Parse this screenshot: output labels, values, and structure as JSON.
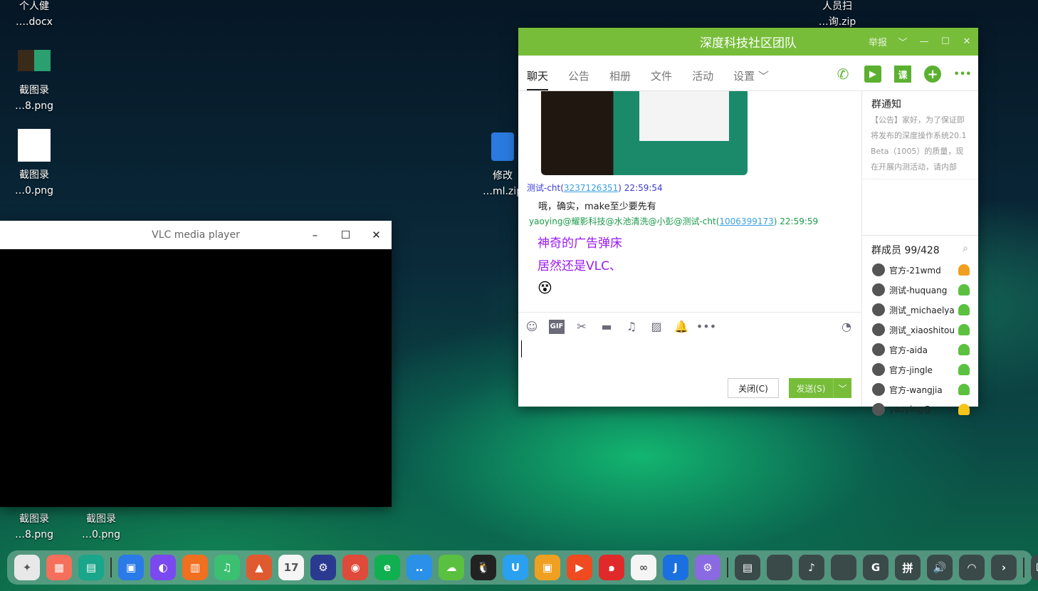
{
  "desktop": {
    "icons": [
      {
        "line1": "个人健",
        "line2": "….docx"
      },
      {
        "line1": "截图录",
        "line2": "…8.png"
      },
      {
        "line1": "截图录",
        "line2": "…0.png"
      },
      {
        "line1": "修改",
        "line2": "…ml.zip"
      },
      {
        "line1": "人员扫",
        "line2": "…询.zip"
      },
      {
        "line1": "截图录",
        "line2": "…8.png"
      },
      {
        "line1": "截图录",
        "line2": "…0.png"
      }
    ]
  },
  "vlc": {
    "title": "VLC media player",
    "minimize": "–",
    "maximize": "☐",
    "close": "✕"
  },
  "qq": {
    "title": "深度科技社区团队",
    "report": "举报",
    "dropdown": "﹀",
    "minimize": "—",
    "maximize": "☐",
    "close": "✕",
    "tabs": [
      "聊天",
      "公告",
      "相册",
      "文件",
      "活动",
      "设置 ﹀"
    ],
    "tools": {
      "voice": "✆",
      "video": "▶",
      "course": "课",
      "add": "+",
      "more": "•••"
    },
    "messages": [
      {
        "sender": "测试-cht(",
        "id": "3237126351",
        "close": ")",
        "time": "22:59:54",
        "text": "哦，确实，make至少要先有"
      },
      {
        "sender": "yaoying@耀影科技@水池清洗@小彭@测试-cht(",
        "id": "1006399173",
        "close": ")",
        "time": "22:59:59",
        "lines": [
          "神奇的广告弹床",
          "居然还是VLC、"
        ],
        "emoji": "😵"
      }
    ],
    "input_tools": {
      "emoji": "☺",
      "gif": "GIF",
      "scissors": "✂",
      "folder": "▬",
      "music": "♫",
      "image": "▨",
      "bell": "🔔",
      "more": "•••",
      "history": "◔"
    },
    "close_button": "关闭(C)",
    "send_button": "发送(S)",
    "send_dropdown": "﹀",
    "notice": {
      "title": "群通知",
      "text": "【公告】家好，为了保证即将发布的深度操作系统20.1 Beta（1005）的质量，现在开展内测活动，请内部测..."
    },
    "members": {
      "title": "群成员 99/428",
      "search": "⌕",
      "list": [
        {
          "name": "官方-21wmd",
          "role": "#f0a020"
        },
        {
          "name": "测试-huquang",
          "role": "#5cc040"
        },
        {
          "name": "测试_michaelya",
          "role": "#5cc040"
        },
        {
          "name": "测试_xiaoshitou",
          "role": "#5cc040"
        },
        {
          "name": "官方-aida",
          "role": "#5cc040"
        },
        {
          "name": "官方-jingle",
          "role": "#5cc040"
        },
        {
          "name": "官方-wangjia",
          "role": "#5cc040"
        },
        {
          "name": "yaoying@",
          "role": "#f5c518"
        }
      ]
    }
  },
  "dock": {
    "items": [
      {
        "icon": "launcher-icon",
        "color": "#e8e8e8",
        "glyph": "✦"
      },
      {
        "icon": "multitask-icon",
        "color": "#f56f5a",
        "glyph": "▦"
      },
      {
        "icon": "desktop-icon",
        "color": "#1aa68a",
        "glyph": "▤"
      },
      {
        "sep": true
      },
      {
        "icon": "file-manager-icon",
        "color": "#2a7ae8",
        "glyph": "▣"
      },
      {
        "icon": "browser-icon",
        "color": "#7a4af0",
        "glyph": "◐"
      },
      {
        "icon": "app-store-icon",
        "color": "#f07020",
        "glyph": "▥"
      },
      {
        "icon": "music-icon",
        "color": "#3ac070",
        "glyph": "♫"
      },
      {
        "icon": "photos-icon",
        "color": "#e05a30",
        "glyph": "▲"
      },
      {
        "icon": "calendar-icon",
        "color": "#f5f5f5",
        "glyph": "17"
      },
      {
        "icon": "settings-icon",
        "color": "#2a3a90",
        "glyph": "⚙"
      },
      {
        "icon": "chrome-icon",
        "color": "#e04a3a",
        "glyph": "◉"
      },
      {
        "icon": "edge-icon",
        "color": "#10b050",
        "glyph": "e"
      },
      {
        "icon": "chat-bubble-icon",
        "color": "#2a90e8",
        "glyph": "‥"
      },
      {
        "icon": "wechat-icon",
        "color": "#5ac040",
        "glyph": "☁"
      },
      {
        "icon": "qq-icon",
        "color": "#222",
        "glyph": "🐧"
      },
      {
        "icon": "cup-icon",
        "color": "#2aa0f0",
        "glyph": "U"
      },
      {
        "icon": "vm-icon",
        "color": "#f0a020",
        "glyph": "▣"
      },
      {
        "icon": "video-icon",
        "color": "#f04a20",
        "glyph": "▶"
      },
      {
        "icon": "netease-music-icon",
        "color": "#e02a2a",
        "glyph": "๑"
      },
      {
        "icon": "baidu-disk-icon",
        "color": "#f5f5f5",
        "glyph": "∞"
      },
      {
        "icon": "j-app-icon",
        "color": "#1a70e0",
        "glyph": "J"
      },
      {
        "icon": "config-icon",
        "color": "#8a6ae0",
        "glyph": "⚙"
      },
      {
        "sep": true
      },
      {
        "icon": "tray-app-icon",
        "color": "#3a4a48",
        "glyph": "▤"
      },
      {
        "icon": "tray-blank-icon",
        "color": "#3a4a48",
        "glyph": ""
      },
      {
        "icon": "tray-music-icon",
        "color": "#3a4a48",
        "glyph": "♪"
      },
      {
        "icon": "tray-blank2-icon",
        "color": "#3a4a48",
        "glyph": ""
      },
      {
        "icon": "tray-g-icon",
        "color": "#3a4a48",
        "glyph": "G"
      },
      {
        "icon": "input-method-icon",
        "color": "#3a4a48",
        "glyph": "拼"
      },
      {
        "icon": "volume-icon",
        "color": "#3a4a48",
        "glyph": "🔊"
      },
      {
        "icon": "wifi-icon",
        "color": "#3a4a48",
        "glyph": "◠"
      },
      {
        "icon": "expand-icon",
        "color": "#3a4a48",
        "glyph": "›"
      },
      {
        "sep": true
      },
      {
        "icon": "keyboard-icon",
        "color": "#3a4a48",
        "glyph": "⌨"
      },
      {
        "icon": "power-icon",
        "color": "#3a4a48",
        "glyph": "⏻"
      }
    ]
  }
}
